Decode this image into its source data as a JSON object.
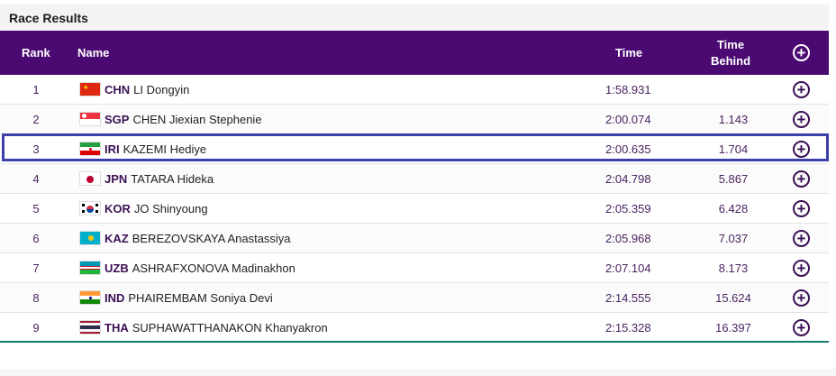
{
  "panel": {
    "title": "Race Results"
  },
  "columns": {
    "rank": "Rank",
    "name": "Name",
    "time": "Time",
    "behind": "Time\nBehind"
  },
  "icons": {
    "expand": "plus-circle-icon"
  },
  "colors": {
    "header_bg": "#4b0a72",
    "highlight_border": "#3d40a8",
    "footer_line": "#167a6e"
  },
  "rows": [
    {
      "rank": "1",
      "noc": "CHN",
      "name": "LI Dongyin",
      "time": "1:58.931",
      "behind": "",
      "flag": "china-flag-icon"
    },
    {
      "rank": "2",
      "noc": "SGP",
      "name": "CHEN Jiexian Stephenie",
      "time": "2:00.074",
      "behind": "1.143",
      "flag": "singapore-flag-icon"
    },
    {
      "rank": "3",
      "noc": "IRI",
      "name": "KAZEMI Hediye",
      "time": "2:00.635",
      "behind": "1.704",
      "flag": "iran-flag-icon"
    },
    {
      "rank": "4",
      "noc": "JPN",
      "name": "TATARA Hideka",
      "time": "2:04.798",
      "behind": "5.867",
      "flag": "japan-flag-icon"
    },
    {
      "rank": "5",
      "noc": "KOR",
      "name": "JO Shinyoung",
      "time": "2:05.359",
      "behind": "6.428",
      "flag": "korea-flag-icon"
    },
    {
      "rank": "6",
      "noc": "KAZ",
      "name": "BEREZOVSKAYA Anastassiya",
      "time": "2:05.968",
      "behind": "7.037",
      "flag": "kazakhstan-flag-icon"
    },
    {
      "rank": "7",
      "noc": "UZB",
      "name": "ASHRAFXONOVA Madinakhon",
      "time": "2:07.104",
      "behind": "8.173",
      "flag": "uzbekistan-flag-icon"
    },
    {
      "rank": "8",
      "noc": "IND",
      "name": "PHAIREMBAM Soniya Devi",
      "time": "2:14.555",
      "behind": "15.624",
      "flag": "india-flag-icon"
    },
    {
      "rank": "9",
      "noc": "THA",
      "name": "SUPHAWATTHANAKON Khanyakron",
      "time": "2:15.328",
      "behind": "16.397",
      "flag": "thailand-flag-icon"
    }
  ]
}
